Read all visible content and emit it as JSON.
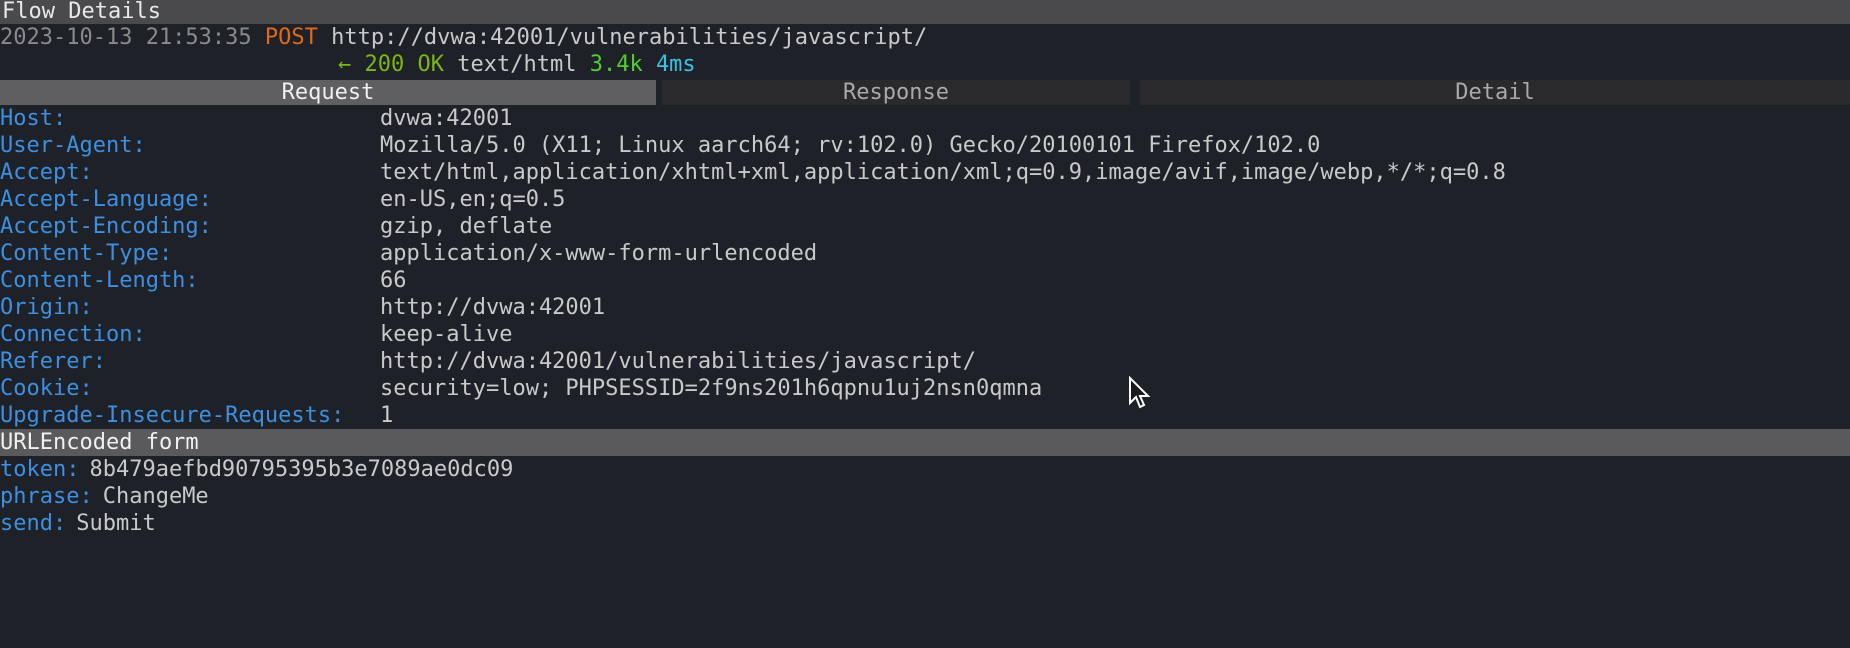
{
  "title": "Flow Details",
  "flow": {
    "timestamp": "2023-10-13 21:53:35",
    "method": "POST",
    "url": "http://dvwa:42001/vulnerabilities/javascript/",
    "arrow": "←",
    "status": "200 OK",
    "content_type": "text/html",
    "size": "3.4k",
    "duration": "4ms"
  },
  "tabs": [
    {
      "label": "Request",
      "active": true
    },
    {
      "label": "Response"
    },
    {
      "label": "Detail"
    }
  ],
  "headers": [
    {
      "key": "Host:",
      "value": "dvwa:42001"
    },
    {
      "key": "User-Agent:",
      "value": "Mozilla/5.0 (X11; Linux aarch64; rv:102.0) Gecko/20100101 Firefox/102.0"
    },
    {
      "key": "Accept:",
      "value": "text/html,application/xhtml+xml,application/xml;q=0.9,image/avif,image/webp,*/*;q=0.8"
    },
    {
      "key": "Accept-Language:",
      "value": "en-US,en;q=0.5"
    },
    {
      "key": "Accept-Encoding:",
      "value": "gzip, deflate"
    },
    {
      "key": "Content-Type:",
      "value": "application/x-www-form-urlencoded"
    },
    {
      "key": "Content-Length:",
      "value": "66"
    },
    {
      "key": "Origin:",
      "value": "http://dvwa:42001"
    },
    {
      "key": "Connection:",
      "value": "keep-alive"
    },
    {
      "key": "Referer:",
      "value": "http://dvwa:42001/vulnerabilities/javascript/"
    },
    {
      "key": "Cookie:",
      "value": "security=low; PHPSESSID=2f9ns201h6qpnu1uj2nsn0qmna"
    },
    {
      "key": "Upgrade-Insecure-Requests:",
      "value": "1"
    }
  ],
  "form": {
    "title": "URLEncoded form",
    "fields": [
      {
        "key": "token:",
        "value": "8b479aefbd90795395b3e7089ae0dc09"
      },
      {
        "key": "phrase:",
        "value": "ChangeMe"
      },
      {
        "key": "send:",
        "value": "Submit"
      }
    ]
  },
  "colors": {
    "method": "#e0691a",
    "status": "#7cb518",
    "size": "#4fcf2a",
    "duration": "#39c2e3",
    "key": "#3d8fe0"
  }
}
